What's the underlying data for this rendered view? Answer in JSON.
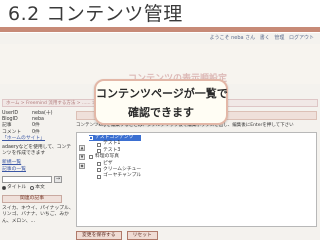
{
  "slide": {
    "title": "6.2 コンテンツ管理"
  },
  "userbar": {
    "greeting": "ようこそ neba さん",
    "items": [
      "書く",
      "管理",
      "ログアウト"
    ]
  },
  "header": {
    "faded_title": "コンテンツの表示順設定"
  },
  "pathbar": {
    "text": "ホーム > Freemind 流用する方法 > ...... > コンテンツの表示順設定"
  },
  "callout": {
    "line1": "コンテンツページが一覧で",
    "line2": "確認できます"
  },
  "sidebar": {
    "info": [
      {
        "key": "UserID",
        "value": "neba(十)"
      },
      {
        "key": "BlogID",
        "value": "neba"
      },
      {
        "key": "記事",
        "value": "0件"
      },
      {
        "key": "コメント",
        "value": "0件"
      }
    ],
    "my_site_link": "「ホームのサイト」",
    "description": "adaeryなどを使用して、コンテンツを作成できます",
    "new_post_link": "新規一覧",
    "admin_link": "記事の一覧",
    "search_button": "→",
    "radio_options": [
      "タイトル",
      "本文"
    ],
    "tags_box": "関連の記事",
    "tags_text": "スイカ、キウイ、パイナップル、リンゴ、バナナ、いちご、みかん、メロン、..."
  },
  "main": {
    "heading": "コンテンツの表示順設定",
    "hint": "コンテンツkeyを編集することは、ダブルクリック後で編集ボックスを出し、編集後にEnterを押して下さい",
    "tree_side_buttons": [
      "▲",
      "▼",
      "◆"
    ],
    "tree": [
      {
        "label": "テストコンテンツ",
        "level": 0,
        "selected": true
      },
      {
        "label": "テスト1",
        "level": 1,
        "selected": false
      },
      {
        "label": "テスト3",
        "level": 1,
        "selected": false
      },
      {
        "label": "料理の写真",
        "level": 0,
        "selected": false
      },
      {
        "label": "ピザ",
        "level": 1,
        "selected": false
      },
      {
        "label": "クリームシチュー",
        "level": 1,
        "selected": false
      },
      {
        "label": "ゴーヤチャンプル",
        "level": 1,
        "selected": false
      }
    ],
    "buttons": [
      "変更を保存する",
      "リセット"
    ]
  }
}
